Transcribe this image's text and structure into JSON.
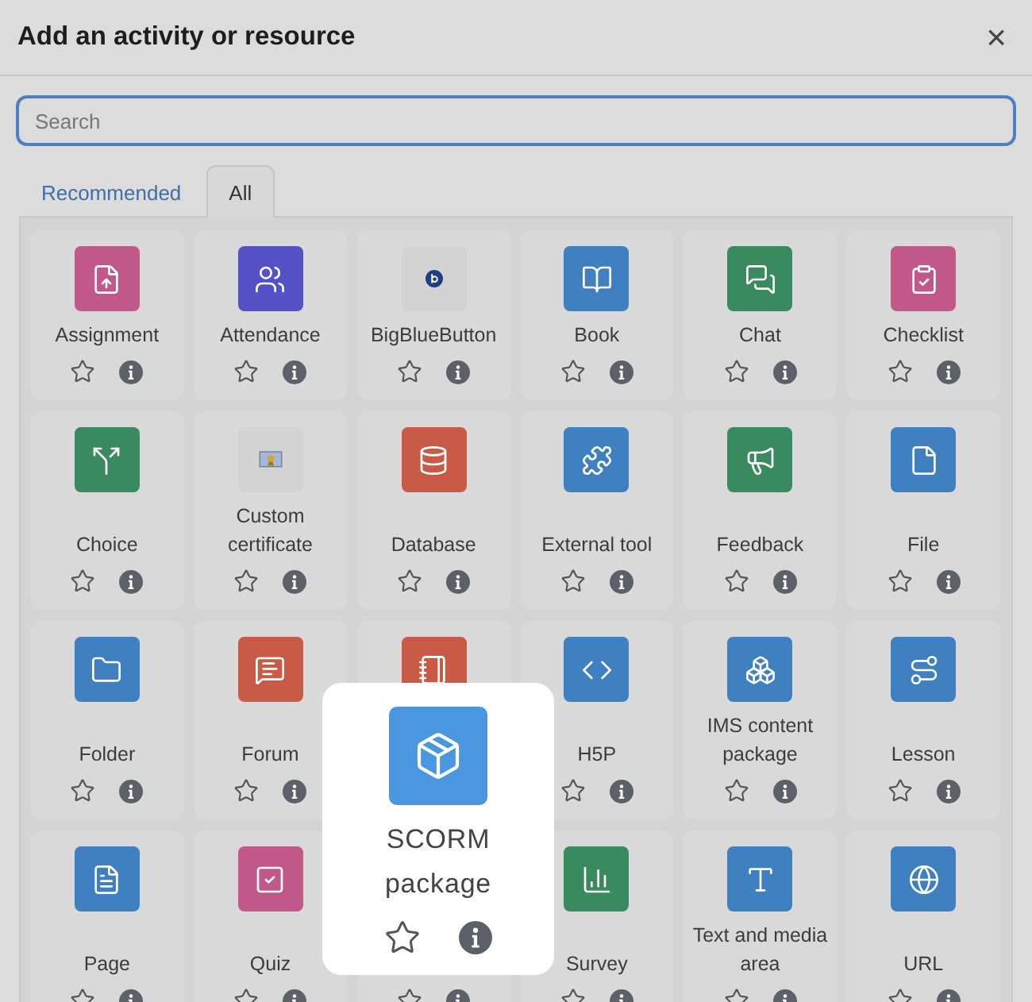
{
  "dialog": {
    "title": "Add an activity or resource",
    "close": "×"
  },
  "search": {
    "placeholder": "Search"
  },
  "tabs": [
    {
      "label": "Recommended",
      "selected": false
    },
    {
      "label": "All",
      "selected": true
    }
  ],
  "items": [
    {
      "label": "Assignment",
      "kind": "assignment",
      "color": "#c0598a",
      "starred": false
    },
    {
      "label": "Attendance",
      "kind": "attendance",
      "color": "#5450c6",
      "starred": false
    },
    {
      "label": "BigBlueButton",
      "kind": "bigbluebutton",
      "color": "#d3d3d3",
      "starred": false
    },
    {
      "label": "Book",
      "kind": "book",
      "color": "#3f80c0",
      "starred": false
    },
    {
      "label": "Chat",
      "kind": "chat",
      "color": "#3a8a5f",
      "starred": false
    },
    {
      "label": "Checklist",
      "kind": "checklist",
      "color": "#c0598a",
      "starred": false
    },
    {
      "label": "Choice",
      "kind": "choice",
      "color": "#3a8a5f",
      "starred": false
    },
    {
      "label": "Custom certificate",
      "kind": "certificate",
      "color": "#d3d3d3",
      "starred": false
    },
    {
      "label": "Database",
      "kind": "database",
      "color": "#c95b46",
      "starred": false
    },
    {
      "label": "External tool",
      "kind": "puzzle",
      "color": "#3f80c0",
      "starred": false
    },
    {
      "label": "Feedback",
      "kind": "feedback",
      "color": "#3a8a5f",
      "starred": false
    },
    {
      "label": "File",
      "kind": "file",
      "color": "#3f80c0",
      "starred": false
    },
    {
      "label": "Folder",
      "kind": "folder",
      "color": "#3f80c0",
      "starred": false
    },
    {
      "label": "Forum",
      "kind": "forum",
      "color": "#c95b46",
      "starred": false
    },
    {
      "kind": "notebook",
      "color": "#c95b46"
    },
    {
      "label": "H5P",
      "kind": "h5p",
      "color": "#3f80c0",
      "starred": false
    },
    {
      "label": "IMS content package",
      "kind": "boxes",
      "color": "#3f80c0",
      "starred": false
    },
    {
      "label": "Lesson",
      "kind": "lesson",
      "color": "#3f80c0",
      "starred": false
    },
    {
      "label": "Page",
      "kind": "page",
      "color": "#3f80c0",
      "starred": false
    },
    {
      "label": "Quiz",
      "kind": "quiz",
      "color": "#c0598a",
      "starred": false
    },
    {
      "starred": false
    },
    {
      "label": "Survey",
      "kind": "survey",
      "color": "#3a8a5f",
      "starred": false
    },
    {
      "label": "Text and media area",
      "kind": "text",
      "color": "#3f80c0",
      "starred": false
    },
    {
      "label": "URL",
      "kind": "url",
      "color": "#3f80c0",
      "starred": false
    }
  ],
  "spotlight": {
    "label": "SCORM package",
    "kind": "package",
    "color": "#4a97e0",
    "starred": false
  }
}
